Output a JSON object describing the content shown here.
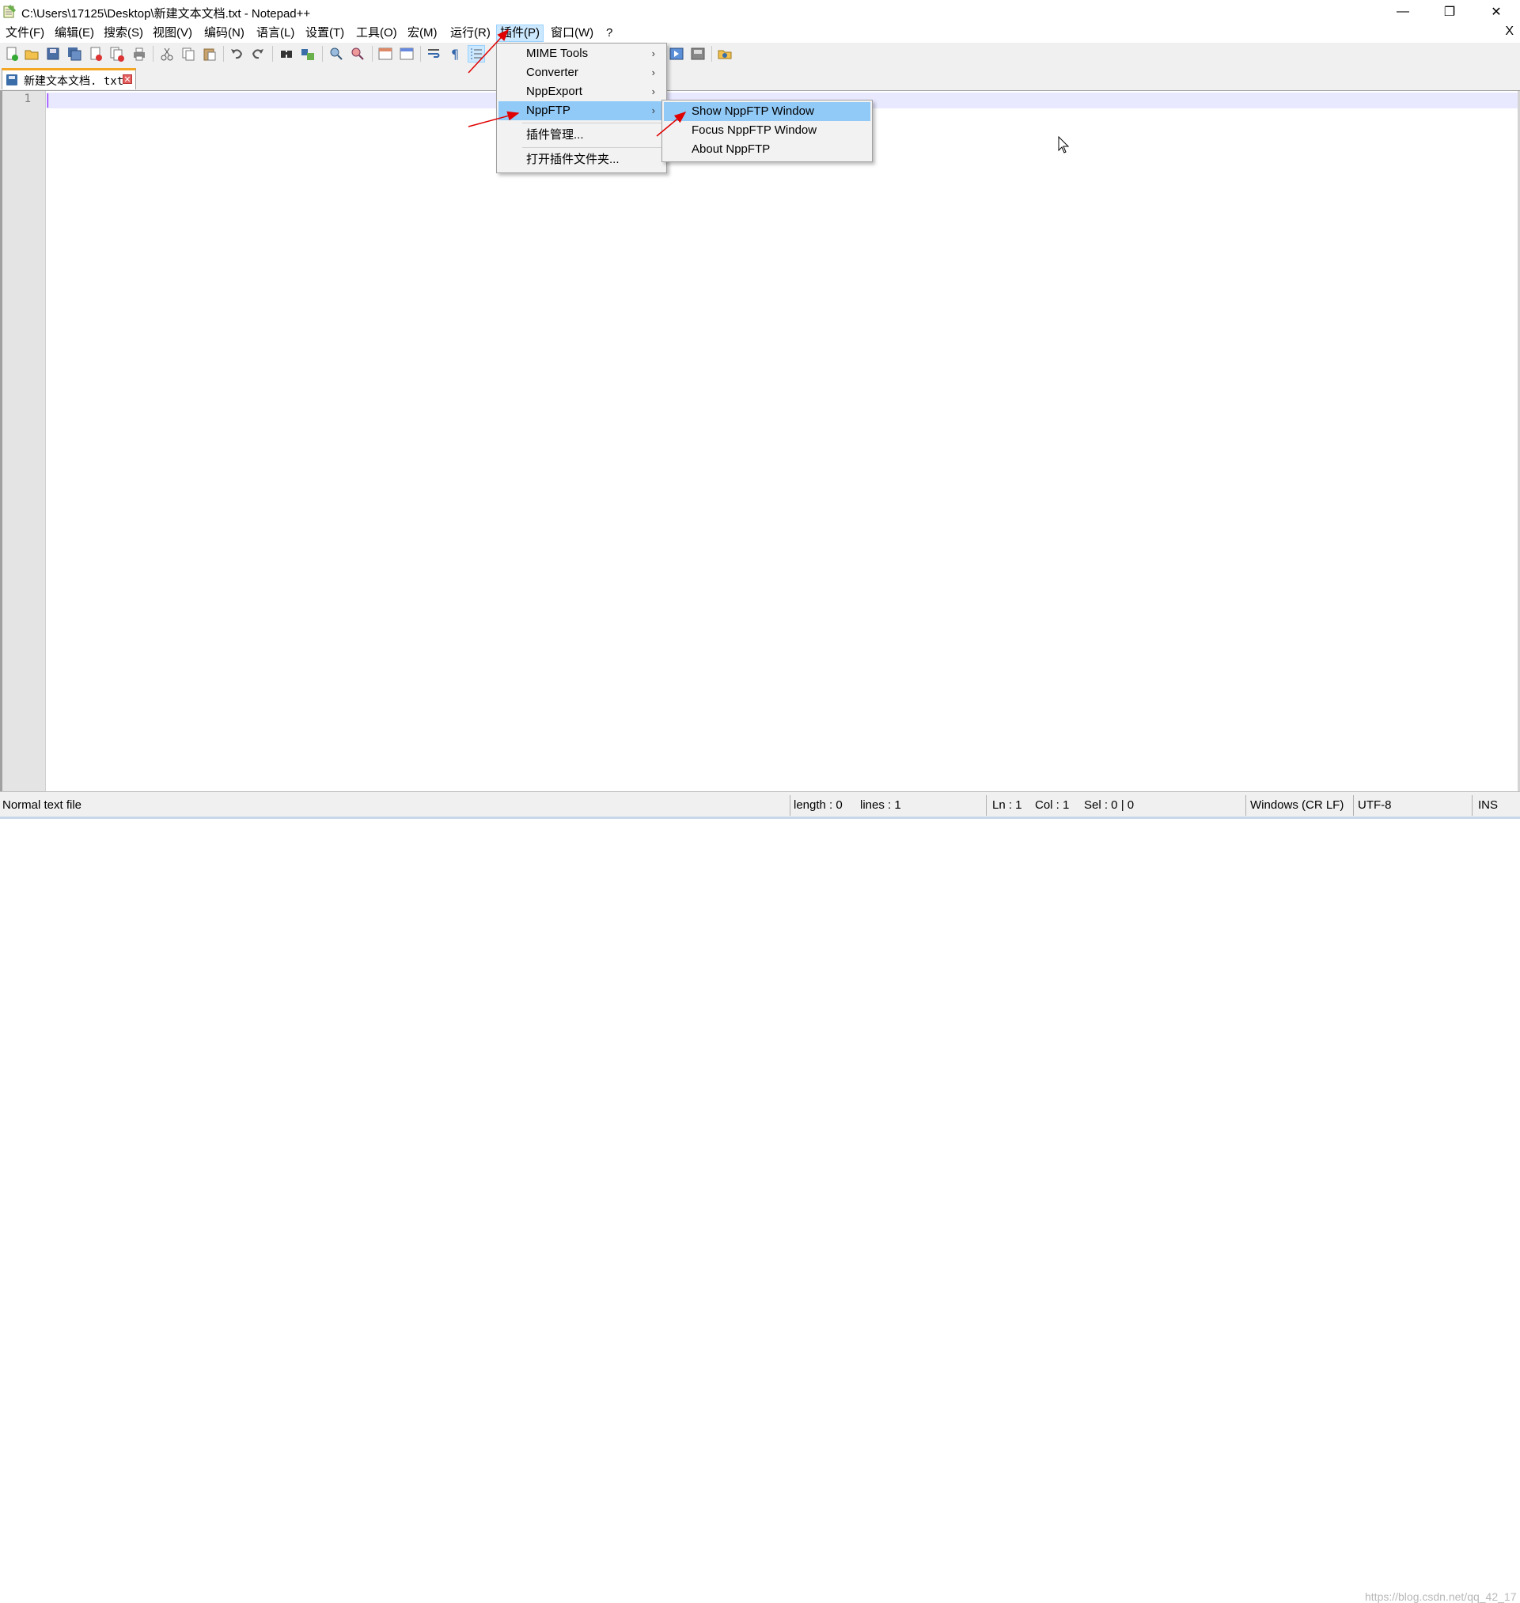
{
  "window": {
    "title": "C:\\Users\\17125\\Desktop\\新建文本文档.txt - Notepad++",
    "minimize": "—",
    "restore": "❐",
    "close": "✕"
  },
  "menubar": {
    "items": [
      {
        "label": "文件(F)"
      },
      {
        "label": "编辑(E)"
      },
      {
        "label": "搜索(S)"
      },
      {
        "label": "视图(V)"
      },
      {
        "label": "编码(N)"
      },
      {
        "label": "语言(L)"
      },
      {
        "label": "设置(T)"
      },
      {
        "label": "工具(O)"
      },
      {
        "label": "宏(M)"
      },
      {
        "label": "运行(R)"
      },
      {
        "label": "插件(P)"
      },
      {
        "label": "窗口(W)"
      },
      {
        "label": "?"
      }
    ],
    "close_doc": "X"
  },
  "tab": {
    "label": "新建文本文档. txt",
    "close": "✕"
  },
  "editor": {
    "line_number": "1"
  },
  "plugins_menu": {
    "items": [
      {
        "label": "MIME Tools",
        "arrow": "›"
      },
      {
        "label": "Converter",
        "arrow": "›"
      },
      {
        "label": "NppExport",
        "arrow": "›"
      },
      {
        "label": "NppFTP",
        "arrow": "›"
      },
      {
        "label": "插件管理..."
      },
      {
        "label": "打开插件文件夹..."
      }
    ]
  },
  "nppftp_submenu": {
    "items": [
      {
        "label": "Show NppFTP Window"
      },
      {
        "label": "Focus NppFTP Window"
      },
      {
        "label": "About NppFTP"
      }
    ]
  },
  "statusbar": {
    "file_type": "Normal text file",
    "length": "length : 0",
    "lines": "lines : 1",
    "ln": "Ln : 1",
    "col": "Col : 1",
    "sel": "Sel : 0 | 0",
    "eol": "Windows (CR LF)",
    "encoding": "UTF-8",
    "mode": "INS",
    "watermark": "https://blog.csdn.net/qq_42_17"
  },
  "colors": {
    "menu_highlight": "#91c9f7",
    "tab_accent": "#f5a623",
    "annotation_arrow": "#e00000"
  }
}
